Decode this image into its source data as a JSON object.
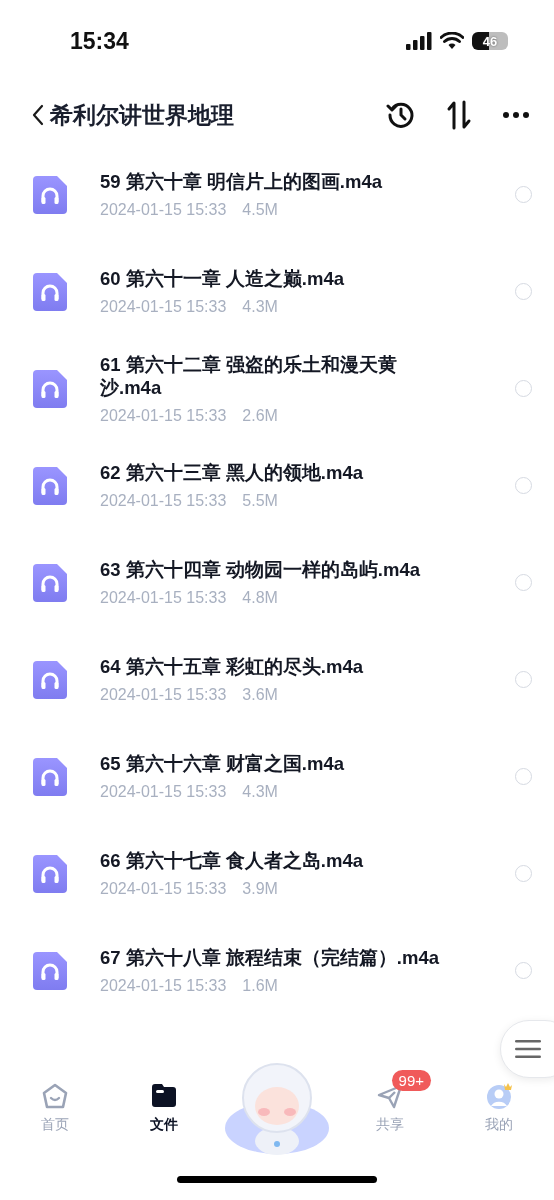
{
  "status_bar": {
    "time": "15:34",
    "battery": "46"
  },
  "header": {
    "title": "希利尔讲世界地理"
  },
  "files": [
    {
      "name": "59 第六十章 明信片上的图画.m4a",
      "date": "2024-01-15 15:33",
      "size": "4.5M",
      "selected": false
    },
    {
      "name": "60 第六十一章 人造之巅.m4a",
      "date": "2024-01-15 15:33",
      "size": "4.3M",
      "selected": false
    },
    {
      "name": "61 第六十二章 强盗的乐土和漫天黄沙.m4a",
      "date": "2024-01-15 15:33",
      "size": "2.6M",
      "selected": false
    },
    {
      "name": "62 第六十三章 黑人的领地.m4a",
      "date": "2024-01-15 15:33",
      "size": "5.5M",
      "selected": false
    },
    {
      "name": "63 第六十四章 动物园一样的岛屿.m4a",
      "date": "2024-01-15 15:33",
      "size": "4.8M",
      "selected": false
    },
    {
      "name": "64 第六十五章 彩虹的尽头.m4a",
      "date": "2024-01-15 15:33",
      "size": "3.6M",
      "selected": false
    },
    {
      "name": "65 第六十六章 财富之国.m4a",
      "date": "2024-01-15 15:33",
      "size": "4.3M",
      "selected": false
    },
    {
      "name": "66 第六十七章 食人者之岛.m4a",
      "date": "2024-01-15 15:33",
      "size": "3.9M",
      "selected": false
    },
    {
      "name": "67 第六十八章 旅程结束（完结篇）.m4a",
      "date": "2024-01-15 15:33",
      "size": "1.6M",
      "selected": false
    }
  ],
  "tab_bar": [
    {
      "kind": "home",
      "label": "首页",
      "selected": false
    },
    {
      "kind": "files",
      "label": "文件",
      "selected": true
    },
    {
      "kind": "mascot"
    },
    {
      "kind": "share",
      "label": "共享",
      "selected": false,
      "badge": "99+"
    },
    {
      "kind": "profile",
      "label": "我的",
      "selected": false
    }
  ]
}
